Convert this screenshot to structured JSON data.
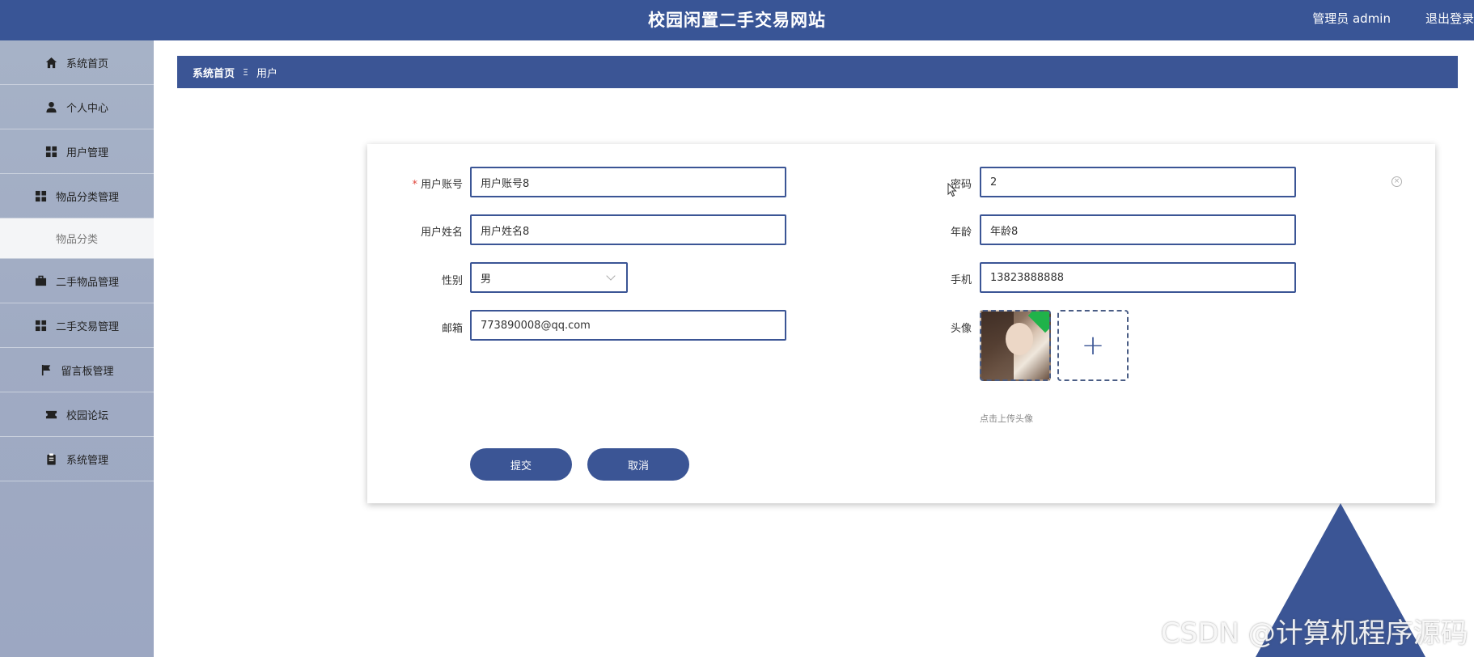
{
  "header": {
    "title": "校园闲置二手交易网站",
    "user_label": "管理员 admin",
    "logout": "退出登录"
  },
  "sidebar": {
    "items": [
      {
        "label": "系统首页",
        "icon": "home-icon"
      },
      {
        "label": "个人中心",
        "icon": "user-icon"
      },
      {
        "label": "用户管理",
        "icon": "grid-icon"
      },
      {
        "label": "物品分类管理",
        "icon": "grid-icon"
      },
      {
        "label": "物品分类",
        "icon": ""
      },
      {
        "label": "二手物品管理",
        "icon": "briefcase-icon"
      },
      {
        "label": "二手交易管理",
        "icon": "grid-icon"
      },
      {
        "label": "留言板管理",
        "icon": "flag-icon"
      },
      {
        "label": "校园论坛",
        "icon": "ticket-icon"
      },
      {
        "label": "系统管理",
        "icon": "clipboard-icon"
      }
    ]
  },
  "breadcrumb": {
    "home": "系统首页",
    "separator": "Ξ",
    "current": "用户"
  },
  "form": {
    "username": {
      "label": "用户账号",
      "required_mark": "*",
      "value": "用户账号8"
    },
    "password": {
      "label": "密码",
      "value": "2"
    },
    "name": {
      "label": "用户姓名",
      "value": "用户姓名8"
    },
    "age": {
      "label": "年龄",
      "value": "年龄8"
    },
    "gender": {
      "label": "性别",
      "value": "男"
    },
    "phone": {
      "label": "手机",
      "value": "13823888888"
    },
    "email": {
      "label": "邮箱",
      "value": "773890008@qq.com"
    },
    "avatar": {
      "label": "头像",
      "hint": "点击上传头像"
    },
    "submit": "提交",
    "cancel": "取消"
  },
  "watermark": "CSDN @计算机程序源码",
  "colors": {
    "primary": "#3b5595",
    "header": "#395596",
    "sidebar": "#a0abc3",
    "required": "#e0463c"
  }
}
